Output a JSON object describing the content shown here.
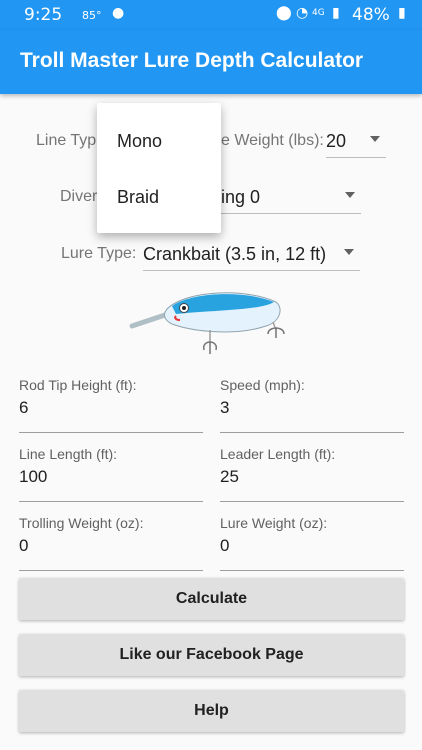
{
  "status_bar": {
    "time": "9:25",
    "temperature": "85°",
    "network": "4G",
    "battery": "48%"
  },
  "app_bar": {
    "title": "Troll Master Lure Depth Calculator"
  },
  "form": {
    "line_type": {
      "label": "Line Typ",
      "value": "Mono"
    },
    "line_weight": {
      "label": "e Weight (lbs):",
      "value": "20"
    },
    "diver": {
      "label": "Diver",
      "value": "ing 0"
    },
    "lure_type": {
      "label": "Lure Type:",
      "value": "Crankbait (3.5 in, 12 ft)"
    },
    "rod_tip_height": {
      "label": "Rod Tip Height (ft):",
      "value": "6"
    },
    "speed": {
      "label": "Speed (mph):",
      "value": "3"
    },
    "line_length": {
      "label": "Line Length (ft):",
      "value": "100"
    },
    "leader_length": {
      "label": "Leader Length (ft):",
      "value": "25"
    },
    "trolling_weight": {
      "label": "Trolling Weight (oz):",
      "value": "0"
    },
    "lure_weight": {
      "label": "Lure Weight (oz):",
      "value": "0"
    }
  },
  "buttons": {
    "calculate": "Calculate",
    "facebook": "Like our Facebook Page",
    "help": "Help"
  },
  "line_type_menu": {
    "options": [
      "Mono",
      "Braid"
    ]
  },
  "colors": {
    "primary": "#2196f3",
    "button": "#e0e0e0"
  }
}
